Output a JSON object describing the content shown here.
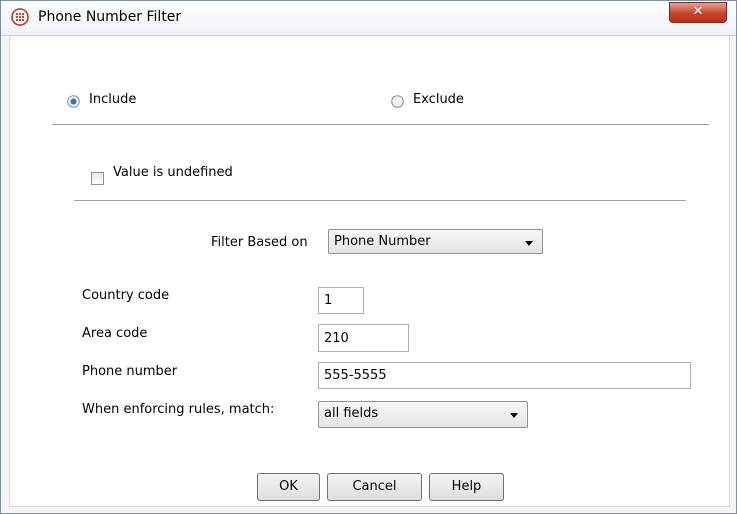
{
  "window": {
    "title": "Phone Number Filter",
    "close_glyph": "✕"
  },
  "mode": {
    "include_label": "Include",
    "exclude_label": "Exclude",
    "selected": "include"
  },
  "undefined_checkbox": {
    "label": "Value is undefined",
    "checked": false
  },
  "filter_based_on": {
    "label": "Filter Based on",
    "value": "Phone Number"
  },
  "fields": {
    "country_code": {
      "label": "Country code",
      "value": "1"
    },
    "area_code": {
      "label": "Area code",
      "value": "210"
    },
    "phone_number": {
      "label": "Phone number",
      "value": "555-5555"
    },
    "match": {
      "label": "When enforcing rules, match:",
      "value": "all fields"
    }
  },
  "buttons": {
    "ok": "OK",
    "cancel": "Cancel",
    "help": "Help"
  },
  "icons": {
    "app": "telephone-keypad-icon",
    "close": "close-icon",
    "dropdown": "chevron-down-icon"
  },
  "colors": {
    "app_icon": "#c8321e",
    "close_button": "#c7432c",
    "radio_selected": "#2f72c4"
  }
}
